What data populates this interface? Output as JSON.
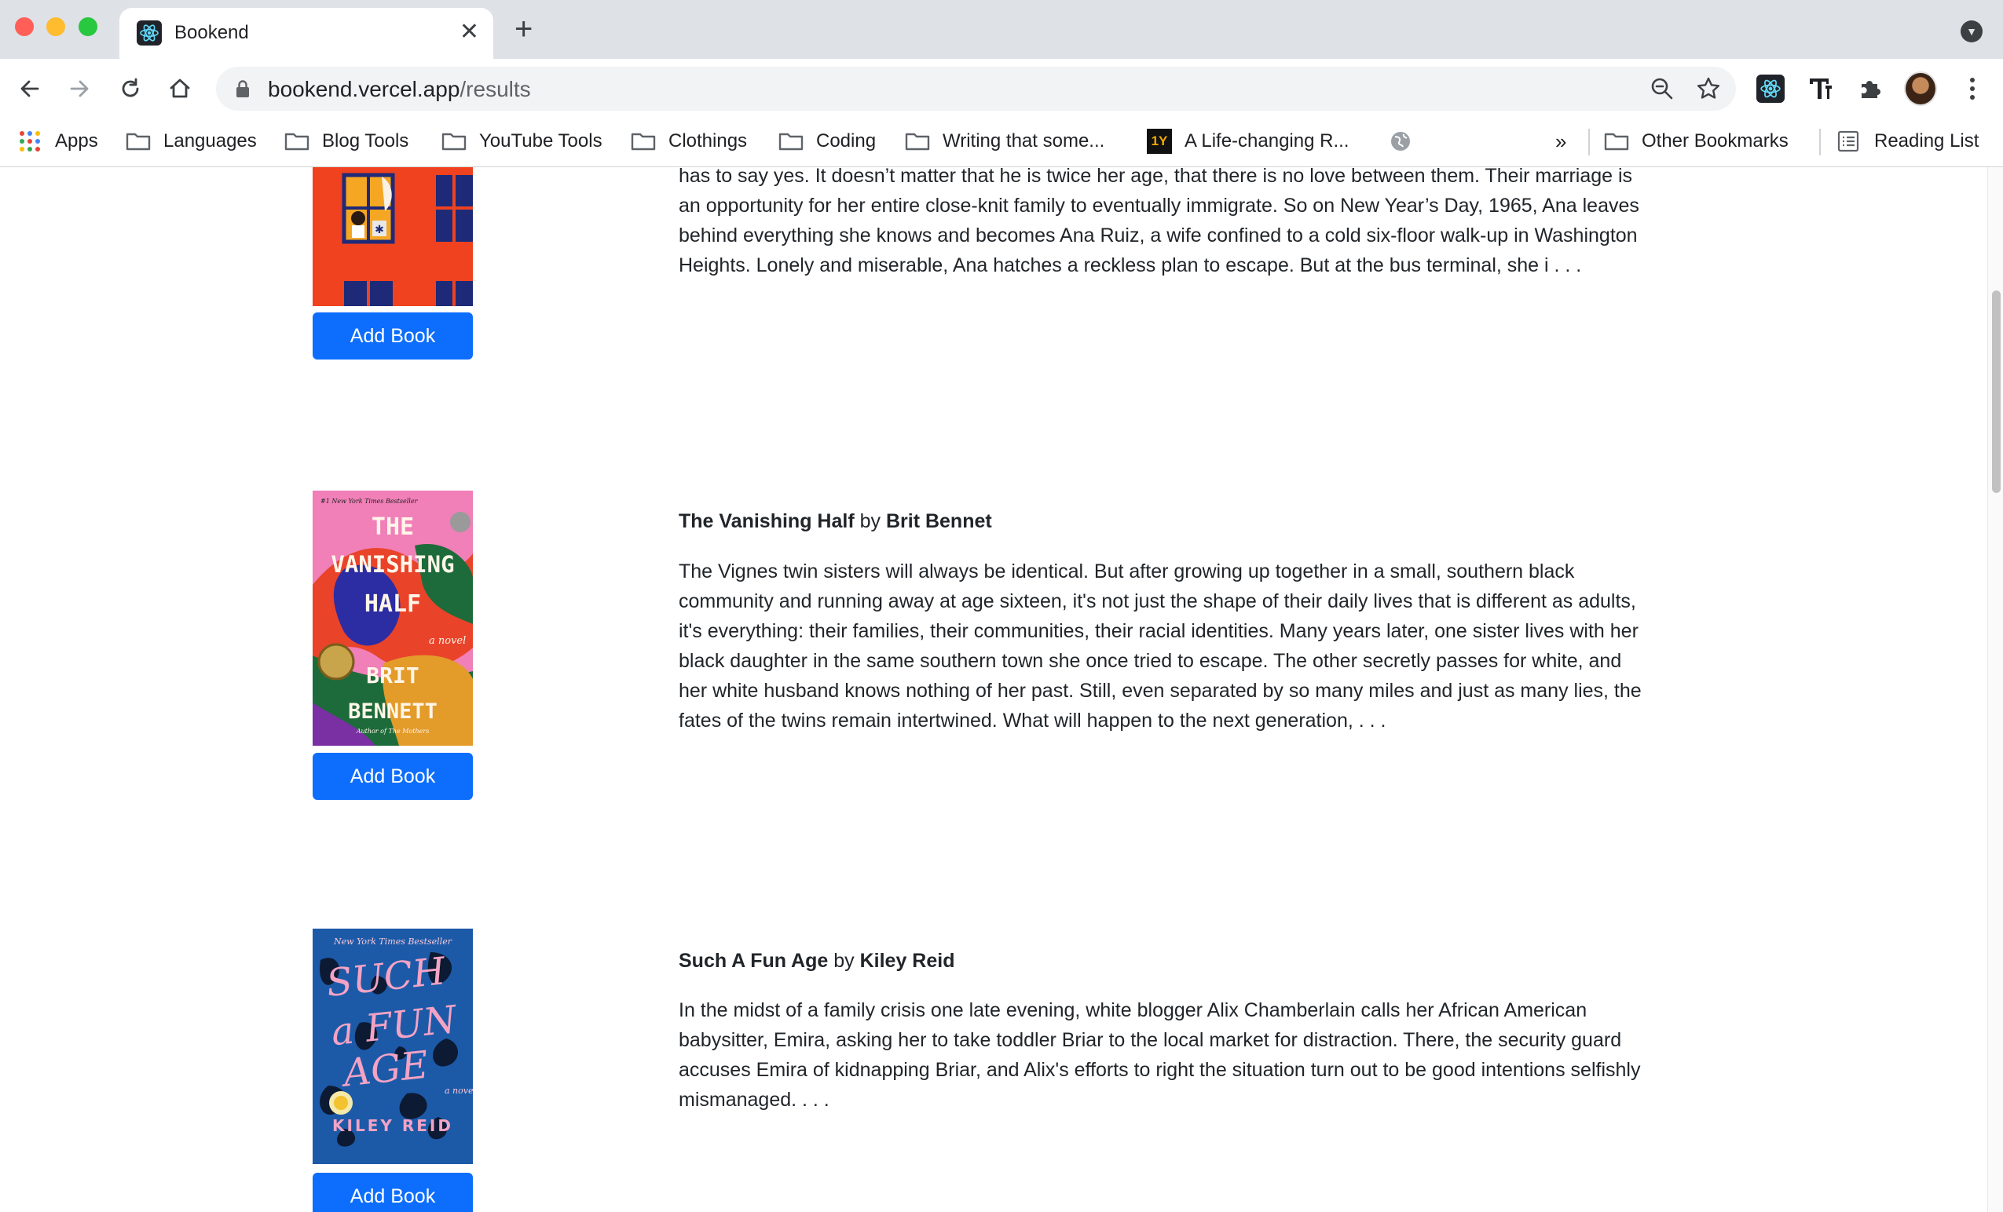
{
  "browser": {
    "tab_title": "Bookend",
    "url_domain": "bookend.vercel.app",
    "url_path": "/results",
    "bookmarks": [
      {
        "label": "Apps",
        "icon": "apps-grid-icon"
      },
      {
        "label": "Languages",
        "icon": "folder-icon"
      },
      {
        "label": "Blog Tools",
        "icon": "folder-icon"
      },
      {
        "label": "YouTube Tools",
        "icon": "folder-icon"
      },
      {
        "label": "Clothings",
        "icon": "folder-icon"
      },
      {
        "label": "Coding",
        "icon": "folder-icon"
      },
      {
        "label": "Writing that some...",
        "icon": "folder-icon"
      },
      {
        "label": "A Life-changing R...",
        "icon": "site-favicon-icon"
      }
    ],
    "overflow_label": "»",
    "other_bookmarks": "Other Bookmarks",
    "reading_list": "Reading List"
  },
  "books": [
    {
      "title": "",
      "author": "",
      "by": "",
      "description": "In the Dominican countryside and But when Juan Ruiz proposes and promises to take her to New York City, she has to say yes. It doesn’t matter that he is twice her age, that there is no love between them. Their marriage is an opportunity for her entire close-knit family to eventually immigrate. So on New Year’s Day, 1965, Ana leaves behind everything she knows and becomes Ana Ruiz, a wife confined to a cold six-floor walk-up in Washington Heights. Lonely and miserable, Ana hatches a reckless plan to escape. But at the bus terminal, she i . . .",
      "button": "Add Book",
      "cover_colors": {
        "bg": "#f0421f",
        "window": "#1e2a78"
      }
    },
    {
      "title": "The Vanishing Half",
      "by": "by",
      "author": "Brit Bennet",
      "description": "The Vignes twin sisters will always be identical. But after growing up together in a small, southern black community and running away at age sixteen, it's not just the shape of their daily lives that is different as adults, it's everything: their families, their communities, their racial identities. Many years later, one sister lives with her black daughter in the same southern town she once tried to escape. The other secretly passes for white, and her white husband knows nothing of her past. Still, even separated by so many miles and just as many lies, the fates of the twins remain intertwined. What will happen to the next generation, . . .",
      "button": "Add Book",
      "cover_text": {
        "tagline": "#1 New York Times Bestseller",
        "line1": "THE",
        "line2": "VANISHING",
        "line3": "HALF",
        "novel": "a novel",
        "author1": "BRIT",
        "author2": "BENNETT",
        "credit": "Author of The Mothers"
      }
    },
    {
      "title": "Such A Fun Age",
      "by": "by",
      "author": "Kiley Reid",
      "description": "In the midst of a family crisis one late evening, white blogger Alix Chamberlain calls her African American babysitter, Emira, asking her to take toddler Briar to the local market for distraction. There, the security guard accuses Emira of kidnapping Briar, and Alix's efforts to right the situation turn out to be good intentions selfishly mismanaged. . . .",
      "button": "Add Book",
      "cover_text": {
        "tagline": "New York Times Bestseller",
        "line1": "SUCH",
        "line2": "a FUN",
        "line3": "AGE",
        "novel": "a novel",
        "author": "KILEY REID"
      }
    }
  ],
  "colors": {
    "button_blue": "#0d6efd",
    "text": "#212529"
  }
}
